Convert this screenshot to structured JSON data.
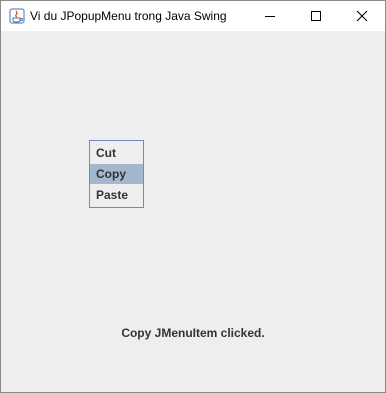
{
  "window": {
    "title": "Vi du JPopupMenu trong Java Swing",
    "icons": {
      "app": "java-icon",
      "minimize": "minimize-icon",
      "maximize": "maximize-icon",
      "close": "close-icon"
    }
  },
  "popup_menu": {
    "items": [
      {
        "label": "Cut",
        "highlighted": false
      },
      {
        "label": "Copy",
        "highlighted": true
      },
      {
        "label": "Paste",
        "highlighted": false
      }
    ],
    "highlight_color": "#a3b8cc",
    "border_color": "#6b8bc9"
  },
  "status": {
    "text": "Copy JMenuItem clicked."
  },
  "colors": {
    "background": "#eeeeee",
    "titlebar": "#ffffff",
    "text": "#333333"
  }
}
